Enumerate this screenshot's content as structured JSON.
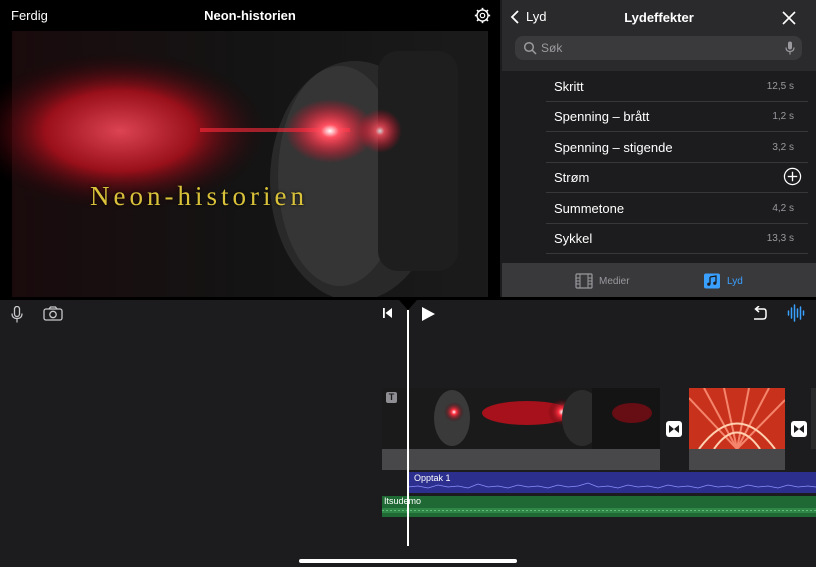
{
  "preview": {
    "done_label": "Ferdig",
    "project_title": "Neon-historien",
    "overlay_title": "Neon-historien"
  },
  "sound_panel": {
    "back_label": "Lyd",
    "title": "Lydeffekter",
    "search_placeholder": "Søk",
    "items": [
      {
        "name": "Skritt",
        "duration": "12,5 s"
      },
      {
        "name": "Spenning – brått",
        "duration": "1,2 s"
      },
      {
        "name": "Spenning – stigende",
        "duration": "3,2 s"
      },
      {
        "name": "Strøm",
        "duration": ""
      },
      {
        "name": "Summetone",
        "duration": "4,2 s"
      },
      {
        "name": "Sykkel",
        "duration": "13,3 s"
      }
    ],
    "tabs": [
      {
        "label": "Medier",
        "icon": "film-icon"
      },
      {
        "label": "Lyd",
        "icon": "music-icon"
      }
    ],
    "accent_color": "#3aa0ff"
  },
  "timeline": {
    "audio_tracks": [
      {
        "label": "Opptak 1",
        "color": "#2c2f8e"
      },
      {
        "label": "Itsudemo",
        "color": "#1f6a34"
      }
    ]
  }
}
